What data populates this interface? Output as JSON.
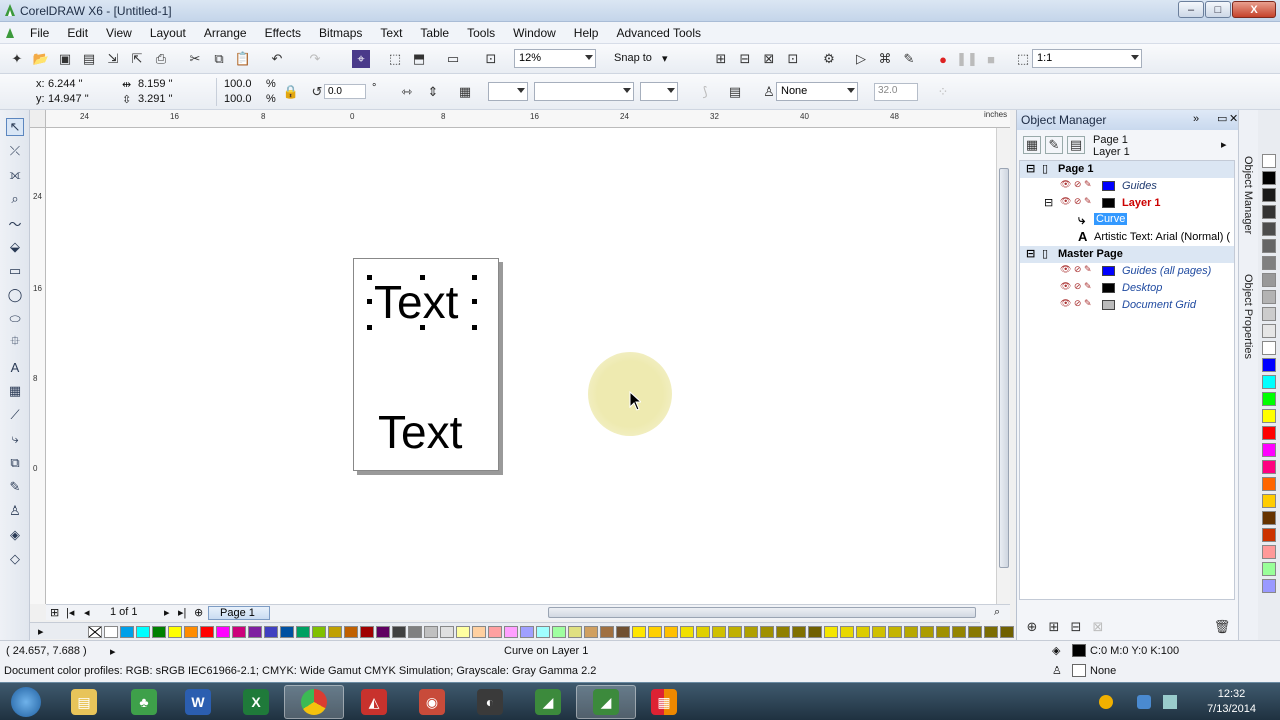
{
  "window": {
    "title": "CorelDRAW X6 - [Untitled-1]",
    "minimize": "–",
    "maximize": "□",
    "close": "X"
  },
  "menu": [
    "File",
    "Edit",
    "View",
    "Layout",
    "Arrange",
    "Effects",
    "Bitmaps",
    "Text",
    "Table",
    "Tools",
    "Window",
    "Help",
    "Advanced Tools"
  ],
  "toolbar": {
    "zoom": "12%",
    "snap_to": "Snap to",
    "scale": "1:1"
  },
  "property_bar": {
    "x_label": "x:",
    "x_value": "6.244 \"",
    "y_label": "y:",
    "y_value": "14.947 \"",
    "width_value": "8.159 \"",
    "height_value": "3.291 \"",
    "scale_x": "100.0",
    "scale_y": "100.0",
    "percent": "%",
    "rotation": "0.0",
    "degree": "°",
    "outline": "None",
    "outline_width": "32.0"
  },
  "ruler": {
    "units": "inches",
    "top_ticks": [
      "24",
      "16",
      "8",
      "0",
      "8",
      "16",
      "24",
      "32",
      "40",
      "48"
    ],
    "left_ticks": [
      "24",
      "16",
      "8",
      "0"
    ]
  },
  "canvas": {
    "text_selected": "Text",
    "text_plain": "Text"
  },
  "page_nav": {
    "count": "1 of 1",
    "tab": "Page 1"
  },
  "object_manager": {
    "title": "Object Manager",
    "page_label": "Page 1",
    "layer_label": "Layer 1",
    "tree": [
      {
        "label": "Page 1",
        "type": "group"
      },
      {
        "label": "Guides",
        "type": "layer",
        "color": "#0000ff"
      },
      {
        "label": "Layer 1",
        "type": "layer-active",
        "color": "#000000"
      },
      {
        "label": "Curve",
        "type": "object-selected"
      },
      {
        "label": "Artistic Text: Arial (Normal) (",
        "type": "object"
      },
      {
        "label": "Master Page",
        "type": "group"
      },
      {
        "label": "Guides (all pages)",
        "type": "master",
        "color": "#0000ff"
      },
      {
        "label": "Desktop",
        "type": "master",
        "color": "#000000"
      },
      {
        "label": "Document Grid",
        "type": "master",
        "color": "#bbbbbb"
      }
    ]
  },
  "side_tabs": {
    "object_manager": "Object Manager",
    "object_properties": "Object Properties"
  },
  "status": {
    "coords": "( 24.657, 7.688 )",
    "selection": "Curve on Layer 1",
    "profiles": "Document color profiles: RGB: sRGB IEC61966-2.1; CMYK: Wide Gamut CMYK Simulation; Grayscale: Gray Gamma 2.2",
    "fill": "C:0 M:0 Y:0 K:100",
    "outline": "None"
  },
  "taskbar": {
    "time": "12:32",
    "date": "7/13/2014"
  },
  "palette_colors": [
    "#ffffff",
    "#00a0e9",
    "#00ffff",
    "#008000",
    "#ffff00",
    "#ff8c00",
    "#ff0000",
    "#ff00ff",
    "#cc007a",
    "#7f1fa0",
    "#4040c0",
    "#0050a0",
    "#00a060",
    "#80c000",
    "#c0a000",
    "#c06000",
    "#a00000",
    "#600060",
    "#404040",
    "#808080",
    "#c0c0c0",
    "#e0e0e0",
    "#ffffa0",
    "#ffd0a0",
    "#ffa0a0",
    "#ffa0ff",
    "#a0a0ff",
    "#a0ffff",
    "#a0ffa0",
    "#e0e080",
    "#d0a060",
    "#a07040",
    "#705030",
    "#ffe600",
    "#ffd000",
    "#ffc000",
    "#f0e000",
    "#e0d000",
    "#d0c000",
    "#c0b000",
    "#b0a000",
    "#a09000",
    "#908000",
    "#807000",
    "#706000",
    "#f5e600",
    "#e8d800",
    "#dccc00",
    "#d0c000",
    "#c4b400",
    "#b8a800",
    "#ac9c00",
    "#a09000",
    "#948400",
    "#887800",
    "#7c6c00",
    "#706000"
  ],
  "right_palette": [
    "#ffffff",
    "#000000",
    "#1a1a1a",
    "#333333",
    "#4d4d4d",
    "#666666",
    "#808080",
    "#999999",
    "#b3b3b3",
    "#cccccc",
    "#e6e6e6",
    "#ffffff",
    "#0000ff",
    "#00ffff",
    "#00ff00",
    "#ffff00",
    "#ff0000",
    "#ff00ff",
    "#ff0080",
    "#ff6600",
    "#ffcc00",
    "#663300",
    "#cc3300",
    "#ff9999",
    "#99ff99",
    "#9999ff"
  ]
}
